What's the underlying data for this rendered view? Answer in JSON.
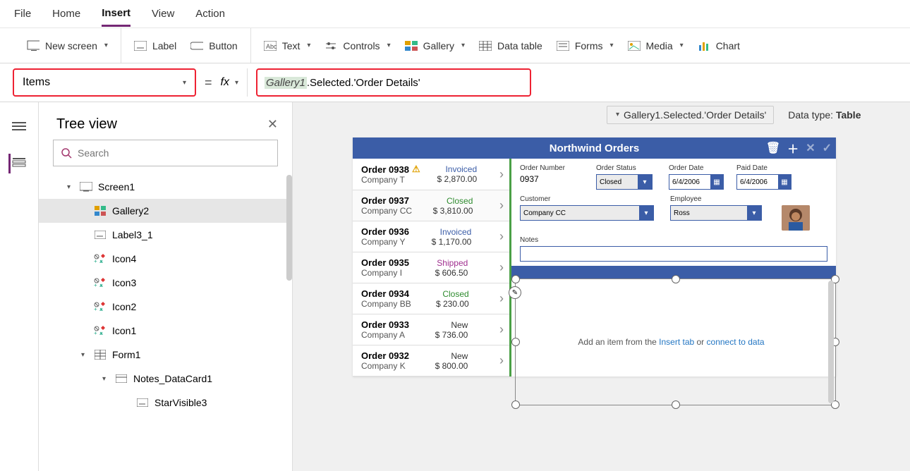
{
  "menu": {
    "items": [
      "File",
      "Home",
      "Insert",
      "View",
      "Action"
    ],
    "active": "Insert"
  },
  "ribbon": {
    "newscreen": "New screen",
    "label": "Label",
    "button": "Button",
    "text": "Text",
    "controls": "Controls",
    "gallery": "Gallery",
    "datatable": "Data table",
    "forms": "Forms",
    "media": "Media",
    "chart": "Chart"
  },
  "prop": {
    "selected": "Items",
    "fx": "fx",
    "equals": "=",
    "formula_ident": "Gallery1",
    "formula_rest": ".Selected.'Order Details'"
  },
  "subinfo": {
    "path": "Gallery1.Selected.'Order Details'",
    "dtlabel": "Data type: ",
    "dtval": "Table"
  },
  "treeview": {
    "title": "Tree view",
    "search_ph": "Search",
    "items": [
      {
        "label": "Screen1",
        "depth": 1,
        "icon": "screen",
        "exp": "▾"
      },
      {
        "label": "Gallery2",
        "depth": 2,
        "icon": "gallery",
        "sel": true
      },
      {
        "label": "Label3_1",
        "depth": 2,
        "icon": "label"
      },
      {
        "label": "Icon4",
        "depth": 2,
        "icon": "iconset"
      },
      {
        "label": "Icon3",
        "depth": 2,
        "icon": "iconset"
      },
      {
        "label": "Icon2",
        "depth": 2,
        "icon": "iconset"
      },
      {
        "label": "Icon1",
        "depth": 2,
        "icon": "iconset"
      },
      {
        "label": "Form1",
        "depth": 2,
        "icon": "form",
        "exp": "▾"
      },
      {
        "label": "Notes_DataCard1",
        "depth": 3,
        "icon": "card",
        "exp": "▾"
      },
      {
        "label": "StarVisible3",
        "depth": 4,
        "icon": "label"
      }
    ]
  },
  "app": {
    "title": "Northwind Orders",
    "orders": [
      {
        "id": "Order 0938",
        "company": "Company T",
        "amount": "$ 2,870.00",
        "status": "Invoiced",
        "scls": "st-invoiced",
        "warn": true
      },
      {
        "id": "Order 0937",
        "company": "Company CC",
        "amount": "$ 3,810.00",
        "status": "Closed",
        "scls": "st-closed",
        "sel": true
      },
      {
        "id": "Order 0936",
        "company": "Company Y",
        "amount": "$ 1,170.00",
        "status": "Invoiced",
        "scls": "st-invoiced"
      },
      {
        "id": "Order 0935",
        "company": "Company I",
        "amount": "$ 606.50",
        "status": "Shipped",
        "scls": "st-shipped"
      },
      {
        "id": "Order 0934",
        "company": "Company BB",
        "amount": "$ 230.00",
        "status": "Closed",
        "scls": "st-closed"
      },
      {
        "id": "Order 0933",
        "company": "Company A",
        "amount": "$ 736.00",
        "status": "New",
        "scls": "st-new"
      },
      {
        "id": "Order 0932",
        "company": "Company K",
        "amount": "$ 800.00",
        "status": "New",
        "scls": "st-new"
      }
    ],
    "detail": {
      "ordnum_lbl": "Order Number",
      "ordnum": "0937",
      "ordstat_lbl": "Order Status",
      "ordstat": "Closed",
      "orddate_lbl": "Order Date",
      "orddate": "6/4/2006",
      "paiddate_lbl": "Paid Date",
      "paiddate": "6/4/2006",
      "cust_lbl": "Customer",
      "cust": "Company CC",
      "emp_lbl": "Employee",
      "emp": "Ross",
      "notes_lbl": "Notes"
    },
    "placeholder_pre": "Add an item from the ",
    "placeholder_link1": "Insert tab",
    "placeholder_mid": " or ",
    "placeholder_link2": "connect to data"
  }
}
